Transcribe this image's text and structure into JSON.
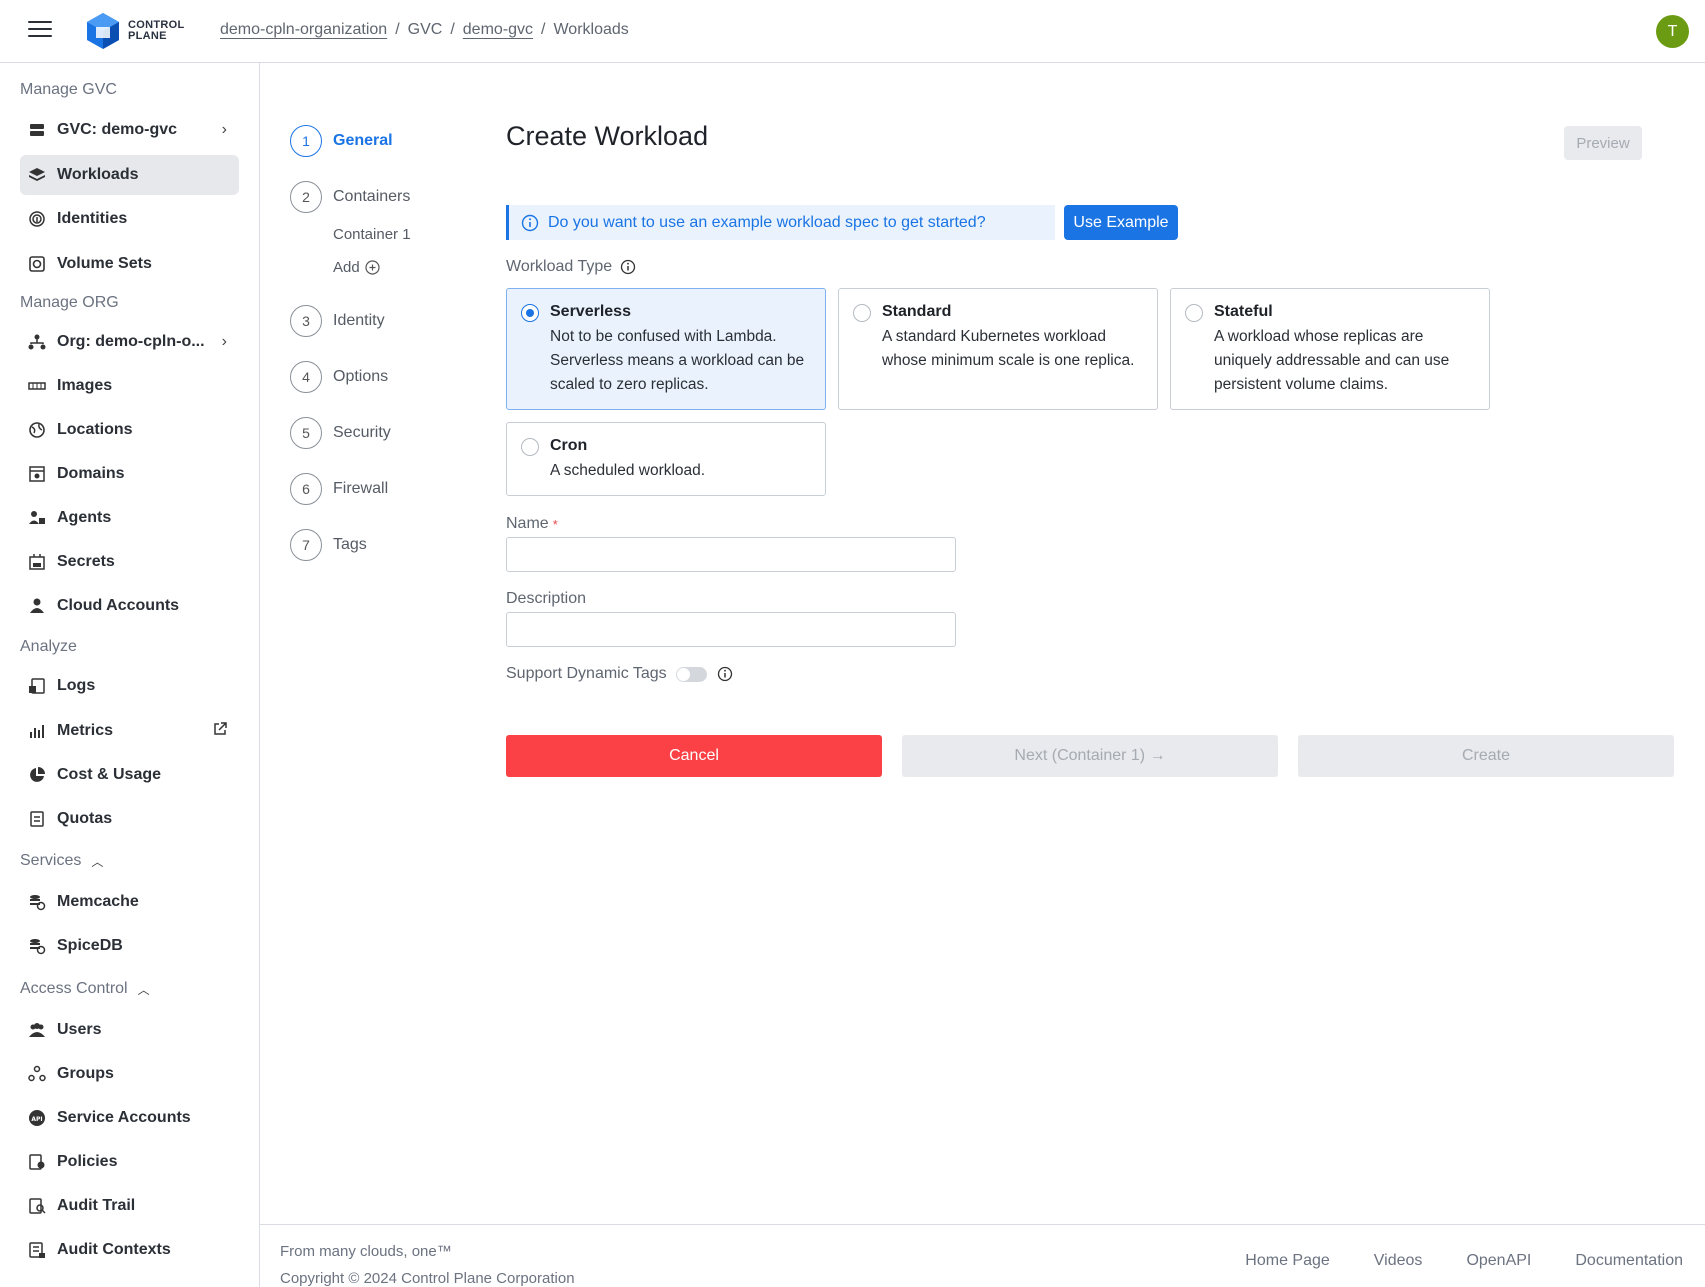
{
  "header": {
    "logo_line1": "CONTROL",
    "logo_line2": "PLANE",
    "breadcrumb": [
      "demo-cpln-organization",
      "GVC",
      "demo-gvc",
      "Workloads"
    ],
    "avatar_initial": "T"
  },
  "sidebar": {
    "manage_gvc": "Manage GVC",
    "gvc_item": "GVC: demo-gvc",
    "workloads": "Workloads",
    "identities": "Identities",
    "volume_sets": "Volume Sets",
    "manage_org": "Manage ORG",
    "org_item": "Org: demo-cpln-o...",
    "images": "Images",
    "locations": "Locations",
    "domains": "Domains",
    "agents": "Agents",
    "secrets": "Secrets",
    "cloud_accounts": "Cloud Accounts",
    "analyze": "Analyze",
    "logs": "Logs",
    "metrics": "Metrics",
    "cost_usage": "Cost & Usage",
    "quotas": "Quotas",
    "services": "Services",
    "memcache": "Memcache",
    "spicedb": "SpiceDB",
    "access_control": "Access Control",
    "users": "Users",
    "groups": "Groups",
    "service_accounts": "Service Accounts",
    "policies": "Policies",
    "audit_trail": "Audit Trail",
    "audit_contexts": "Audit Contexts"
  },
  "stepper": {
    "steps": [
      {
        "num": "1",
        "label": "General"
      },
      {
        "num": "2",
        "label": "Containers"
      },
      {
        "num": "3",
        "label": "Identity"
      },
      {
        "num": "4",
        "label": "Options"
      },
      {
        "num": "5",
        "label": "Security"
      },
      {
        "num": "6",
        "label": "Firewall"
      },
      {
        "num": "7",
        "label": "Tags"
      }
    ],
    "container1": "Container 1",
    "add": "Add"
  },
  "form": {
    "title": "Create Workload",
    "preview": "Preview",
    "info_text": "Do you want to use an example workload spec to get started?",
    "use_example": "Use Example",
    "workload_type_label": "Workload Type",
    "types": {
      "serverless": {
        "title": "Serverless",
        "desc": "Not to be confused with Lambda. Serverless means a workload can be scaled to zero replicas."
      },
      "standard": {
        "title": "Standard",
        "desc": "A standard Kubernetes workload whose minimum scale is one replica."
      },
      "stateful": {
        "title": "Stateful",
        "desc": "A workload whose replicas are uniquely addressable and can use persistent volume claims."
      },
      "cron": {
        "title": "Cron",
        "desc": "A scheduled workload."
      }
    },
    "name_label": "Name",
    "name_required": "*",
    "name_value": "",
    "description_label": "Description",
    "description_value": "",
    "dynamic_tags_label": "Support Dynamic Tags",
    "cancel": "Cancel",
    "next": "Next (Container 1) →",
    "create": "Create"
  },
  "footer": {
    "tagline": "From many clouds, one™",
    "copyright": "Copyright © 2024 Control Plane Corporation",
    "links": [
      "Home Page",
      "Videos",
      "OpenAPI",
      "Documentation"
    ]
  },
  "colors": {
    "accent": "#1a74e4",
    "cancel": "#fb4145",
    "avatar": "#6b9b12"
  }
}
